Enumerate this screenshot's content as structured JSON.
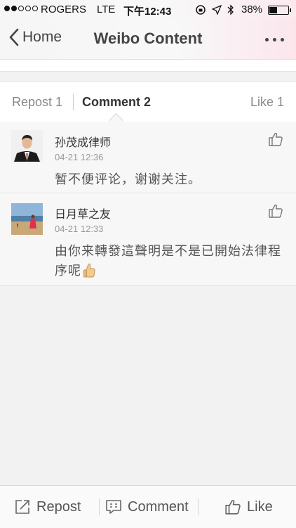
{
  "status_bar": {
    "carrier": "ROGERS",
    "network": "LTE",
    "time": "下午12:43",
    "battery_percent": "38%",
    "battery_level": 0.38
  },
  "nav": {
    "back_label": "Home",
    "title": "Weibo Content",
    "more_icon": "more-dots-icon"
  },
  "tabs": [
    {
      "label": "Repost 1"
    },
    {
      "label": "Comment 2"
    },
    {
      "label": "Like 1"
    }
  ],
  "comments": [
    {
      "user": "孙茂成律师",
      "time": "04-21 12:36",
      "text": "暂不便评论，谢谢关注。"
    },
    {
      "user": "日月草之友",
      "time": "04-21 12:33",
      "text": "由你来轉發這聲明是不是已開始法律程序呢"
    }
  ],
  "toolbar": {
    "repost_label": "Repost",
    "comment_label": "Comment",
    "like_label": "Like"
  }
}
